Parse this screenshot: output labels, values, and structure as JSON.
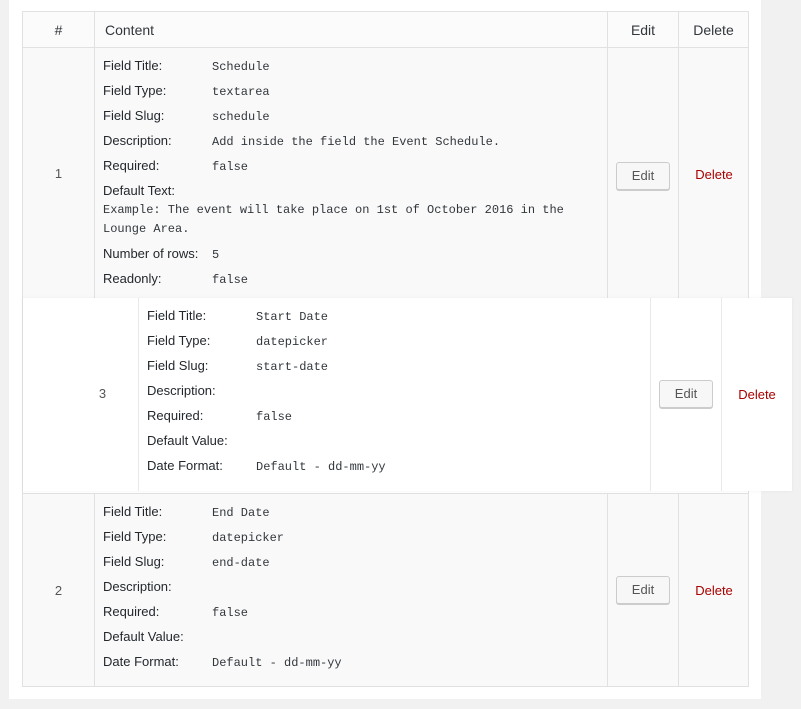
{
  "header": {
    "num": "#",
    "content": "Content",
    "edit": "Edit",
    "delete": "Delete"
  },
  "labels": {
    "field_title": "Field Title:",
    "field_type": "Field Type:",
    "field_slug": "Field Slug:",
    "description": "Description:",
    "required": "Required:",
    "default_text": "Default Text:",
    "number_of_rows": "Number of rows:",
    "readonly": "Readonly:",
    "default_value": "Default Value:",
    "date_format": "Date Format:"
  },
  "rows": [
    {
      "num": "1",
      "field_title": "Schedule",
      "field_type": "textarea",
      "field_slug": "schedule",
      "description": "Add inside the field the Event Schedule.",
      "required": "false",
      "default_text": "Example: The event will take place on 1st of October 2016 in the Lounge Area.",
      "number_of_rows": "5",
      "readonly": "false",
      "edit": "Edit",
      "delete": "Delete"
    },
    {
      "num": "3",
      "field_title": "Start Date",
      "field_type": "datepicker",
      "field_slug": "start-date",
      "description": "",
      "required": "false",
      "default_value": "",
      "date_format": "Default - dd-mm-yy",
      "edit": "Edit",
      "delete": "Delete"
    },
    {
      "num": "2",
      "field_title": "End Date",
      "field_type": "datepicker",
      "field_slug": "end-date",
      "description": "",
      "required": "false",
      "default_value": "",
      "date_format": "Default - dd-mm-yy",
      "edit": "Edit",
      "delete": "Delete"
    }
  ]
}
